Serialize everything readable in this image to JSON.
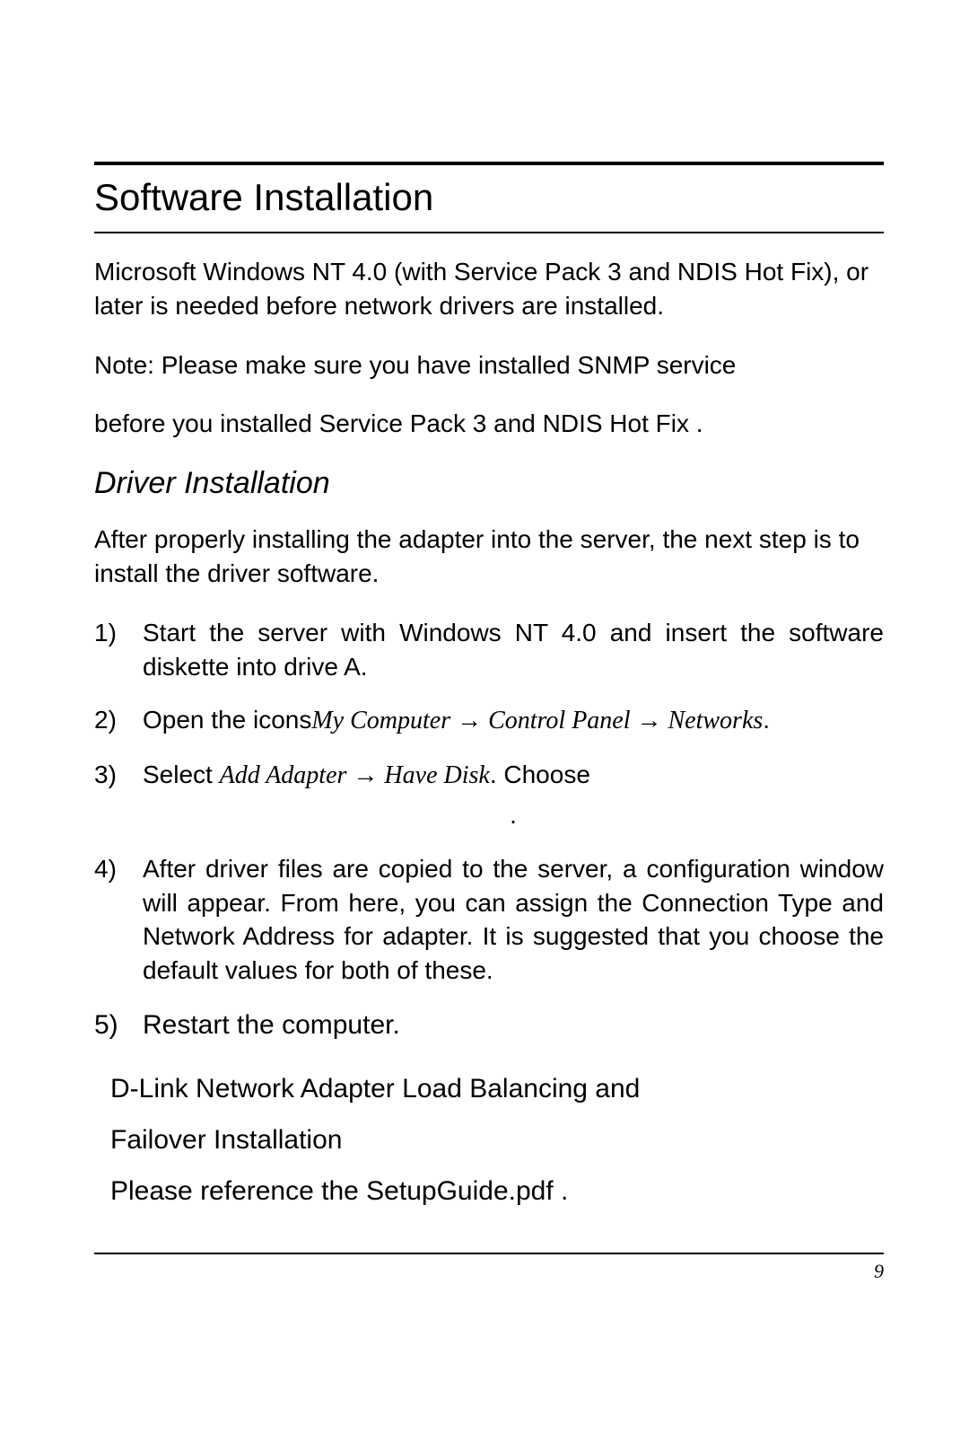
{
  "title": "Software Installation",
  "intro1": "Microsoft Windows NT 4.0 (with Service Pack 3 and NDIS Hot Fix), or later is needed before network drivers are installed.",
  "intro2": "Note: Please make sure you have installed SNMP service",
  "intro3": "before you installed Service Pack 3 and NDIS Hot Fix .",
  "subheading": "Driver Installation",
  "after_sub": "After properly installing the adapter into the server, the next step is to install the driver software.",
  "steps": {
    "n1": "1)",
    "t1": "Start the server with Windows NT 4.0 and insert the software diskette into drive A.",
    "n2": "2)",
    "t2_a": "Open the icons",
    "t2_b": "My Computer → Control Panel → Networks",
    "t2_c": ".",
    "n3": "3)",
    "t3_a": "Select ",
    "t3_b": "Add  Adapter  →  Have  Disk",
    "t3_c": ".      Choose",
    "t3_d": ".",
    "n4": "4)",
    "t4": "After driver files are copied to the server, a configuration window will appear.  From here, you can assign the Connection Type and Network Address for adapter.  It is suggested that you choose the default values for both of these.",
    "n5": "5)",
    "t5": "Restart the computer."
  },
  "tail1": "D-Link Network Adapter Load Balancing and",
  "tail2": "Failover Installation",
  "tail3": "Please reference the  SetupGuide.pdf  .",
  "page_number": "9"
}
